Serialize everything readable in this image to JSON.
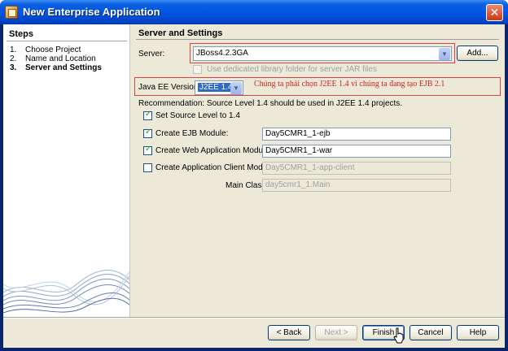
{
  "window": {
    "title": "New Enterprise Application",
    "close_glyph": "✕"
  },
  "steps": {
    "heading": "Steps",
    "items": [
      {
        "num": "1.",
        "label": "Choose Project"
      },
      {
        "num": "2.",
        "label": "Name and Location"
      },
      {
        "num": "3.",
        "label": "Server and Settings"
      }
    ]
  },
  "settings": {
    "heading": "Server and Settings",
    "server_label": "Server:",
    "server_value": "JBoss4.2.3GA",
    "add_button": "Add...",
    "dedicated_lib_label": "Use dedicated library folder for server JAR files",
    "javaee_label": "Java EE Version:",
    "javaee_value": "J2EE 1.4",
    "annotation": "Chúng ta phải chọn J2EE 1.4 vì chúng ta đang tạo EJB 2.1",
    "recommendation": "Recommendation: Source Level 1.4 should be used in J2EE 1.4 projects.",
    "source_level_label": "Set Source Level to 1.4",
    "ejb_label": "Create EJB Module:",
    "ejb_value": "Day5CMR1_1-ejb",
    "web_label": "Create Web Application Module:",
    "web_value": "Day5CMR1_1-war",
    "client_label": "Create Application Client Module:",
    "client_value": "Day5CMR1_1-app-client",
    "main_class_label": "Main Class:",
    "main_class_value": "day5cmr1_1.Main"
  },
  "buttons": {
    "back": "< Back",
    "next": "Next >",
    "finish": "Finish",
    "cancel": "Cancel",
    "help": "Help"
  },
  "colors": {
    "titlebar": "#0054e3",
    "highlight_box": "#e04040",
    "annotation_text": "#d02020",
    "selection": "#316ac5"
  }
}
